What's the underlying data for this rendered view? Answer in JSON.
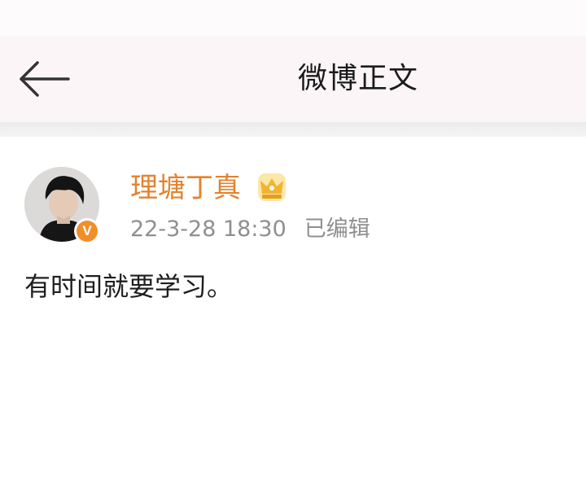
{
  "nav": {
    "title": "微博正文",
    "back_icon": "arrow-left-icon"
  },
  "post": {
    "username": "理塘丁真",
    "verified_badge": "V",
    "vip_icon": "crown-icon",
    "timestamp": "22-3-28 18:30",
    "edited_label": "已编辑",
    "content": "有时间就要学习。"
  },
  "colors": {
    "navbar_bg": "#fcf5f8",
    "username": "#e3822e",
    "badge": "#f08f2a",
    "meta_text": "#8f8f8f"
  }
}
